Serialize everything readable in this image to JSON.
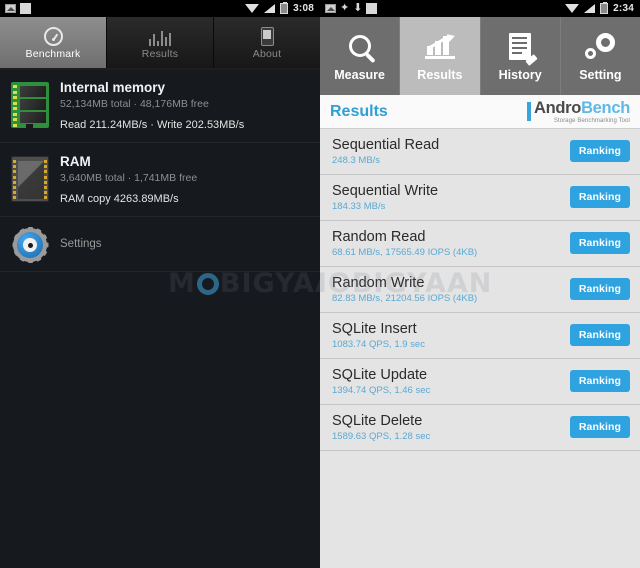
{
  "left_phone": {
    "statusbar": {
      "time": "3:08",
      "icons": [
        "photo-icon",
        "blank-notification-icon",
        "wifi-icon",
        "signal-icon",
        "battery-icon"
      ]
    },
    "tabs": [
      {
        "label": "Benchmark",
        "icon": "gauge-icon",
        "selected": true
      },
      {
        "label": "Results",
        "icon": "bar-chart-icon",
        "selected": false
      },
      {
        "label": "About",
        "icon": "phone-icon",
        "selected": false
      }
    ],
    "rows": [
      {
        "title": "Internal memory",
        "sub": "52,134MB total · 48,176MB free",
        "detail": "Read 211.24MB/s · Write 202.53MB/s",
        "icon": "green-memory-chip-icon"
      },
      {
        "title": "RAM",
        "sub": "3,640MB total · 1,741MB free",
        "detail": "RAM copy 4263.89MB/s",
        "icon": "ram-chip-icon"
      }
    ],
    "settings_label": "Settings",
    "watermark": "MOBIGYAAN"
  },
  "right_phone": {
    "statusbar": {
      "time": "2:34",
      "icons": [
        "photo-icon",
        "star-icon",
        "download-icon",
        "blank-notification-icon",
        "wifi-icon",
        "signal-icon",
        "battery-icon"
      ]
    },
    "tabs": [
      {
        "label": "Measure",
        "icon": "magnifier-icon",
        "selected": false
      },
      {
        "label": "Results",
        "icon": "chart-arrow-icon",
        "selected": true
      },
      {
        "label": "History",
        "icon": "document-pen-icon",
        "selected": false
      },
      {
        "label": "Setting",
        "icon": "gears-icon",
        "selected": false
      }
    ],
    "header": {
      "title": "Results",
      "logo_first": "Andro",
      "logo_second": "Bench",
      "logo_tagline": "Storage Benchmarking Tool"
    },
    "ranking_label": "Ranking",
    "results": [
      {
        "name": "Sequential Read",
        "value": "248.3 MB/s"
      },
      {
        "name": "Sequential Write",
        "value": "184.33 MB/s"
      },
      {
        "name": "Random Read",
        "value": "68.61 MB/s, 17565.49 IOPS (4KB)"
      },
      {
        "name": "Random Write",
        "value": "82.83 MB/s, 21204.56 IOPS (4KB)"
      },
      {
        "name": "SQLite Insert",
        "value": "1083.74 QPS, 1.9 sec"
      },
      {
        "name": "SQLite Update",
        "value": "1394.74 QPS, 1.46 sec"
      },
      {
        "name": "SQLite Delete",
        "value": "1589.63 QPS, 1.28 sec"
      }
    ]
  },
  "colors": {
    "accent_blue": "#2fa3df",
    "header_blue": "#2f9fd4",
    "value_blue": "#5aa9d4",
    "dark_bg": "#16191e",
    "light_bg": "#e4e4e4",
    "tabbar_gray": "#6e6e6e"
  }
}
